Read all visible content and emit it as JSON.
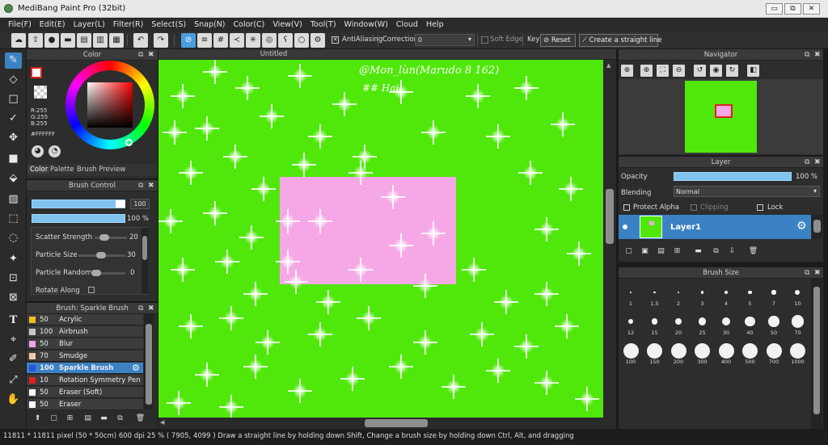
{
  "app": {
    "title": "MediBang Paint Pro (32bit)"
  },
  "menu": [
    "File(F)",
    "Edit(E)",
    "Layer(L)",
    "Filter(R)",
    "Select(S)",
    "Snap(N)",
    "Color(C)",
    "View(V)",
    "Tool(T)",
    "Window(W)",
    "Cloud",
    "Help"
  ],
  "toolbar": {
    "antialias": "AntiAliasing",
    "correction": "Correction",
    "correction_value": "0",
    "soft_edge": "Soft Edge",
    "key": "Key",
    "reset": "Reset",
    "straight_line": "Create a straight line"
  },
  "color_panel": {
    "title": "Color",
    "r": "R:255",
    "g": "G:255",
    "b": "B:255",
    "hex": "#FFFFFF",
    "tabs": [
      "Color",
      "Palette",
      "Brush Preview"
    ]
  },
  "brush_control": {
    "title": "Brush Control",
    "size_value": "100",
    "opacity_value": "100 %",
    "params": [
      {
        "label": "Scatter Strength",
        "value": "20"
      },
      {
        "label": "Particle Size",
        "value": "30"
      },
      {
        "label": "Particle Random",
        "value": "0"
      },
      {
        "label": "Rotate Along",
        "value": ""
      }
    ]
  },
  "brush_list": {
    "title": "Brush: Sparkle Brush",
    "items": [
      {
        "size": "50",
        "name": "Acrylic",
        "color": "#f0c020"
      },
      {
        "size": "100",
        "name": "Airbrush",
        "color": "#c8c8c8"
      },
      {
        "size": "50",
        "name": "Blur",
        "color": "#f2a4e0"
      },
      {
        "size": "70",
        "name": "Smudge",
        "color": "#f4c8a8"
      },
      {
        "size": "100",
        "name": "Sparkle Brush",
        "color": "#2b52d8",
        "selected": true
      },
      {
        "size": "10",
        "name": "Rotation Symmetry Pen",
        "color": "#e02020"
      },
      {
        "size": "50",
        "name": "Eraser (Soft)",
        "color": "#ffffff"
      },
      {
        "size": "50",
        "name": "Eraser",
        "color": "#ffffff"
      }
    ]
  },
  "canvas": {
    "tab": "Untitled",
    "signature_line1": "@Mon_lùn(Marudo 8 162)",
    "signature_line2": "## Hai"
  },
  "navigator": {
    "title": "Navigator"
  },
  "layer": {
    "title": "Layer",
    "opacity_label": "Opacity",
    "opacity_value": "100 %",
    "blending_label": "Blending",
    "blending_value": "Normal",
    "protect_alpha": "Protect Alpha",
    "clipping": "Clipping",
    "lock": "Lock",
    "layer_name": "Layer1"
  },
  "brush_size": {
    "title": "Brush Size",
    "sizes": [
      "1",
      "1.5",
      "2",
      "3",
      "4",
      "5",
      "7",
      "10",
      "12",
      "15",
      "20",
      "25",
      "30",
      "40",
      "50",
      "70",
      "100",
      "150",
      "200",
      "300",
      "400",
      "500",
      "700",
      "1000"
    ]
  },
  "status": {
    "text": "11811 * 11811 pixel  (50 * 50cm)  600 dpi  25 %  ( 7905, 4099 )  Draw a straight line by holding down Shift, Change a brush size by holding down Ctrl, Alt, and dragging"
  }
}
